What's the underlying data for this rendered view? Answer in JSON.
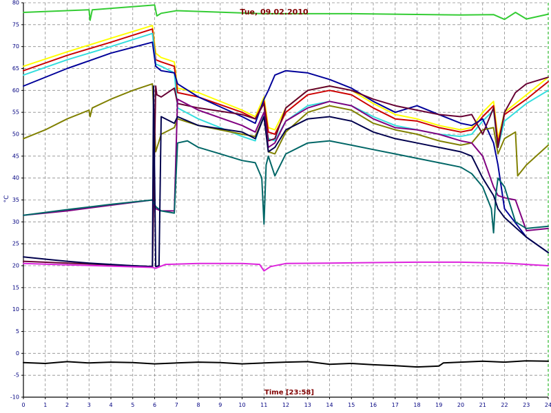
{
  "chart_data": {
    "type": "line",
    "title": "Tue, 09.02.2010",
    "xlabel": "Time [23:58]",
    "ylabel": "°C",
    "xlim": [
      0,
      24
    ],
    "ylim": [
      -10,
      80
    ],
    "x_ticks": [
      0,
      1,
      2,
      3,
      4,
      5,
      6,
      7,
      8,
      9,
      10,
      11,
      12,
      13,
      14,
      15,
      16,
      17,
      18,
      19,
      20,
      21,
      22,
      23,
      24
    ],
    "y_ticks": [
      -10,
      -5,
      0,
      5,
      10,
      15,
      20,
      25,
      30,
      35,
      40,
      45,
      50,
      55,
      60,
      65,
      70,
      75,
      80
    ],
    "grid": true,
    "legend": "none",
    "series": [
      {
        "color": "#33cc33",
        "x": [
          0,
          3,
          3.05,
          3.15,
          6,
          6.1,
          6.3,
          7,
          11,
          15,
          20,
          21.5,
          22.0,
          22.5,
          23,
          24
        ],
        "values": [
          77.8,
          78.4,
          76.0,
          78.4,
          79.5,
          77.0,
          77.6,
          78.2,
          77.5,
          77.5,
          77.2,
          77.3,
          76.2,
          77.8,
          76.3,
          77.4
        ]
      },
      {
        "color": "#ffff00",
        "x": [
          0,
          2,
          4,
          5.9,
          6.05,
          6.3,
          6.9,
          7.05,
          8,
          10,
          10.6,
          11.0,
          11.2,
          11.5,
          12,
          13,
          14,
          15,
          16,
          17,
          18,
          19,
          20,
          20.5,
          21,
          21.5,
          21.7,
          22,
          23,
          24
        ],
        "values": [
          65.5,
          68.8,
          71.9,
          74.8,
          68.5,
          67.5,
          66.5,
          60.5,
          59.5,
          55.5,
          54.0,
          58.5,
          51.5,
          51.0,
          56.0,
          60.0,
          61.0,
          60.0,
          57.0,
          54.5,
          53.5,
          52.0,
          51.0,
          51.5,
          55.0,
          57.5,
          49.0,
          55.0,
          59.0,
          63.0
        ]
      },
      {
        "color": "#cc0000",
        "x": [
          0,
          2,
          4,
          5.9,
          6.05,
          6.3,
          6.9,
          7.05,
          8,
          10,
          10.6,
          11.0,
          11.2,
          11.5,
          12,
          13,
          14,
          15,
          16,
          17,
          18,
          19,
          20,
          20.5,
          21,
          21.5,
          21.7,
          22,
          23,
          24
        ],
        "values": [
          64.5,
          68.0,
          71.0,
          74.0,
          67.0,
          66.5,
          65.5,
          59.5,
          58.5,
          55.0,
          53.5,
          57.5,
          50.5,
          50.0,
          55.0,
          59.0,
          60.0,
          59.0,
          56.0,
          53.5,
          53.0,
          51.5,
          50.5,
          51.0,
          54.0,
          56.5,
          48.0,
          54.5,
          58.0,
          62.0
        ]
      },
      {
        "color": "#33dddd",
        "x": [
          0,
          2,
          4,
          5.9,
          6.05,
          6.3,
          6.9,
          7.05,
          8,
          10,
          10.6,
          11.0,
          11.2,
          11.5,
          12,
          13,
          14,
          15,
          16,
          17,
          18,
          19,
          20,
          20.5,
          21,
          21.5,
          21.7,
          22,
          23,
          24
        ],
        "values": [
          63.5,
          67.0,
          70.0,
          73.0,
          66.0,
          65.5,
          64.0,
          56.0,
          53.5,
          49.5,
          48.5,
          55.0,
          49.0,
          48.5,
          53.0,
          56.5,
          57.5,
          56.5,
          54.0,
          52.0,
          51.0,
          50.0,
          49.5,
          50.0,
          53.0,
          55.5,
          47.0,
          53.0,
          57.0,
          60.0
        ]
      },
      {
        "color": "#000099",
        "x": [
          0,
          2,
          4,
          5.9,
          6.05,
          6.3,
          6.9,
          7.05,
          8,
          10,
          10.6,
          11.0,
          11.2,
          11.5,
          12,
          13,
          14,
          15,
          16,
          17,
          18,
          19,
          20,
          20.5,
          21,
          21.5,
          21.7,
          22,
          23,
          24
        ],
        "values": [
          61.0,
          65.0,
          68.5,
          71.0,
          65.5,
          64.5,
          64.0,
          61.5,
          58.5,
          54.0,
          52.5,
          58.0,
          60.0,
          63.5,
          64.5,
          64.0,
          62.5,
          60.5,
          57.5,
          55.0,
          56.5,
          54.5,
          52.5,
          52.0,
          53.5,
          48.0,
          43.0,
          33.0,
          26.5,
          23.0
        ]
      },
      {
        "color": "#808000",
        "x": [
          0,
          1,
          2,
          3,
          3.05,
          3.15,
          4,
          5,
          5.9,
          6.05,
          6.3,
          6.9,
          7.05,
          8,
          10,
          10.6,
          11.0,
          11.2,
          11.5,
          12,
          13,
          14,
          15,
          16,
          17,
          18,
          19,
          20,
          20.5,
          21,
          21.5,
          21.7,
          22,
          22.5,
          22.6,
          23,
          24
        ],
        "values": [
          49.0,
          51.0,
          53.5,
          55.5,
          54.0,
          56.0,
          58.0,
          60.0,
          61.5,
          46.0,
          50.0,
          51.5,
          53.5,
          52.0,
          50.0,
          49.5,
          54.0,
          46.0,
          45.5,
          50.5,
          55.0,
          56.5,
          55.5,
          52.5,
          51.0,
          50.0,
          48.5,
          47.5,
          48.0,
          51.0,
          51.5,
          45.5,
          49.0,
          50.5,
          40.5,
          43.0,
          47.5
        ]
      },
      {
        "color": "#660033",
        "x": [
          0,
          2,
          4,
          5.9,
          6.05,
          6.1,
          6.3,
          6.9,
          7.05,
          8,
          10,
          10.6,
          11.0,
          11.2,
          11.5,
          12,
          13,
          14,
          15,
          16,
          17,
          18,
          19,
          20,
          20.5,
          21,
          21.5,
          21.7,
          22,
          22.5,
          23,
          24
        ],
        "values": [
          21.0,
          20.6,
          20.2,
          19.8,
          61.0,
          59.0,
          58.5,
          60.5,
          57.0,
          56.0,
          54.5,
          53.5,
          57.0,
          48.5,
          49.0,
          56.0,
          60.0,
          61.0,
          60.0,
          58.0,
          56.5,
          55.5,
          54.5,
          54.0,
          54.5,
          50.0,
          56.0,
          47.0,
          55.0,
          59.5,
          61.5,
          63.0
        ]
      },
      {
        "color": "#800080",
        "x": [
          0,
          2,
          4,
          5.9,
          6.05,
          6.3,
          6.9,
          7.05,
          8,
          10,
          10.6,
          11.0,
          11.2,
          11.5,
          12,
          13,
          14,
          15,
          16,
          17,
          18,
          19,
          20,
          20.5,
          21,
          21.5,
          21.7,
          22,
          22.5,
          23,
          24
        ],
        "values": [
          31.5,
          32.5,
          33.8,
          35.0,
          33.0,
          32.5,
          32.5,
          58.0,
          55.5,
          52.0,
          50.5,
          55.0,
          47.0,
          48.0,
          53.0,
          56.0,
          57.5,
          56.5,
          53.5,
          51.5,
          51.0,
          50.0,
          48.5,
          48.0,
          45.0,
          38.0,
          36.0,
          35.5,
          35.0,
          28.0,
          28.5
        ]
      },
      {
        "color": "#006666",
        "x": [
          0,
          2,
          4,
          5.9,
          6.05,
          6.3,
          6.9,
          7.05,
          7.5,
          8,
          9,
          10,
          10.6,
          10.9,
          11.0,
          11.1,
          11.2,
          11.5,
          12,
          13,
          14,
          15,
          16,
          17,
          18,
          19,
          20,
          20.5,
          21,
          21.4,
          21.5,
          21.6,
          21.7,
          22,
          22.5,
          23,
          24
        ],
        "values": [
          31.5,
          32.8,
          34.0,
          35.0,
          33.5,
          32.5,
          32.0,
          48.0,
          48.5,
          47.0,
          45.5,
          44.0,
          43.5,
          40.0,
          29.5,
          43.0,
          45.0,
          40.5,
          45.5,
          48.0,
          48.5,
          47.5,
          46.5,
          45.5,
          44.5,
          43.5,
          42.5,
          41.0,
          38.0,
          33.0,
          27.5,
          36.0,
          40.0,
          38.0,
          30.0,
          28.5,
          29.0
        ]
      },
      {
        "color": "#00004d",
        "x": [
          0,
          1,
          2,
          3,
          4,
          5,
          5.9,
          5.95,
          6.05,
          6.2,
          6.3,
          6.9,
          7.05,
          8,
          10,
          10.6,
          11.0,
          11.2,
          11.5,
          12,
          13,
          14,
          15,
          16,
          17,
          18,
          19,
          20,
          20.5,
          21,
          21.5,
          21.7,
          22,
          23,
          24
        ],
        "values": [
          22.0,
          21.5,
          21.0,
          20.6,
          20.3,
          20.0,
          19.8,
          61.0,
          19.8,
          20.0,
          54.0,
          52.5,
          54.0,
          52.0,
          50.5,
          49.0,
          54.0,
          46.0,
          47.0,
          51.0,
          53.5,
          54.0,
          53.0,
          50.5,
          49.0,
          48.0,
          47.0,
          46.0,
          45.0,
          40.0,
          36.0,
          33.0,
          31.0,
          26.5,
          23.0
        ]
      },
      {
        "color": "#dd22dd",
        "x": [
          0,
          2,
          4,
          5.9,
          6.05,
          6.5,
          8,
          10,
          10.8,
          11.0,
          11.3,
          12,
          14,
          16,
          18,
          20,
          22,
          24
        ],
        "values": [
          20.5,
          20.2,
          19.9,
          19.6,
          19.4,
          20.3,
          20.5,
          20.5,
          20.3,
          18.8,
          19.8,
          20.5,
          20.6,
          20.7,
          20.8,
          20.8,
          20.6,
          20.0
        ]
      },
      {
        "color": "#000000",
        "x": [
          0,
          1,
          2,
          3,
          4,
          5,
          6,
          7,
          8,
          9,
          10,
          11,
          12,
          13,
          14,
          15,
          16,
          17,
          18,
          19,
          19.2,
          20,
          21,
          22,
          23,
          24
        ],
        "values": [
          -2.1,
          -2.3,
          -1.9,
          -2.2,
          -2.0,
          -2.1,
          -2.4,
          -2.2,
          -2.0,
          -2.1,
          -2.4,
          -2.2,
          -2.0,
          -1.9,
          -2.5,
          -2.3,
          -2.6,
          -2.8,
          -3.1,
          -2.9,
          -2.2,
          -2.0,
          -1.8,
          -2.0,
          -1.7,
          -1.8
        ]
      }
    ]
  }
}
